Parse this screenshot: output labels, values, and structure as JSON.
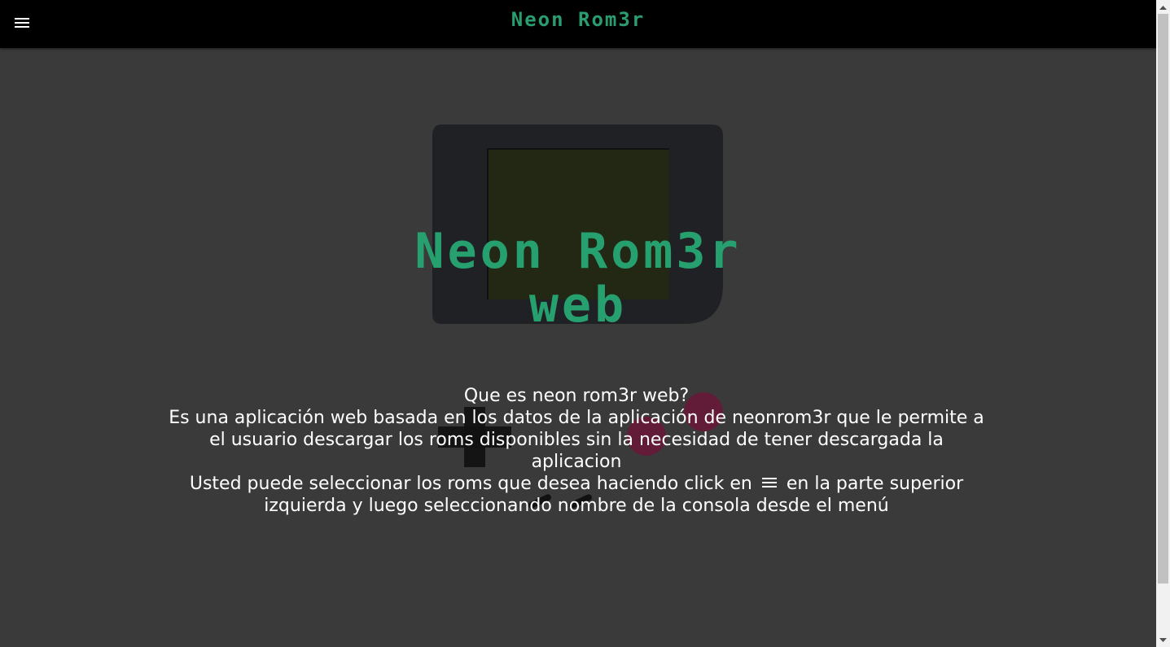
{
  "header": {
    "title": "Neon Rom3r",
    "menu_icon": "hamburger-menu-icon"
  },
  "hero": {
    "title_line1": "Neon Rom3r",
    "title_line2": "web",
    "art_icon": "gameboy-console-icon"
  },
  "intro": {
    "question": "Que es neon rom3r web?",
    "description": "Es una aplicación web basada en los datos de la aplicación de neonrom3r que le permite a el usuario descargar los roms disponibles sin la necesidad de tener descargada la aplicacion",
    "instructions_before": "Usted puede seleccionar los roms que desea haciendo click en",
    "instructions_after": "en la parte superior izquierda y luego seleccionando nombre de la consola desde el menú"
  },
  "colors": {
    "topbar_bg": "#000000",
    "page_bg": "#3a3a3a",
    "accent_green": "#27a070",
    "text": "#ffffff"
  }
}
